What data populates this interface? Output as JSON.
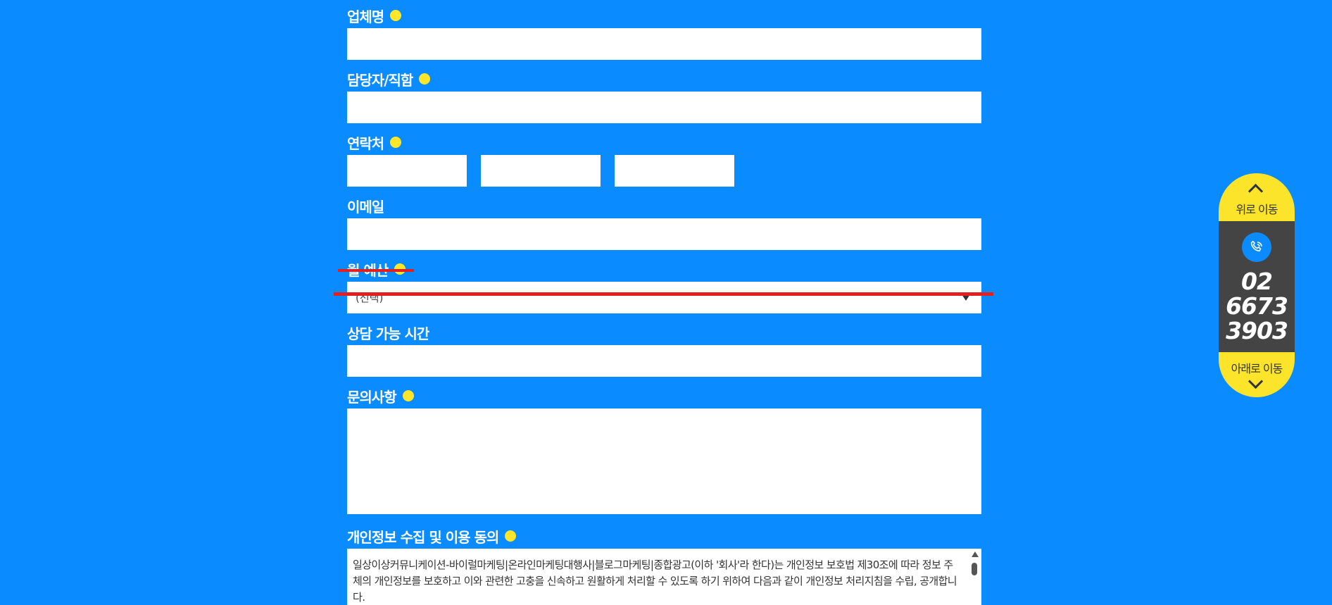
{
  "form": {
    "company_label": "업체명",
    "contact_person_label": "담당자/직함",
    "phone_label": "연락처",
    "email_label": "이메일",
    "budget_label": "월 예산",
    "budget_select_value": "(선택)",
    "consult_time_label": "상담 가능 시간",
    "inquiry_label": "문의사항",
    "privacy_label": "개인정보 수집 및 이용 동의",
    "privacy_text": "일상이상커뮤니케이션-바이럴마케팅|온라인마케팅대행사|블로그마케팅|종합광고(이하 '회사'라 한다)는 개인정보 보호법 제30조에 따라 정보 주체의 개인정보를 보호하고 이와 관련한 고충을 신속하고 원활하게 처리할 수 있도록 하기 위하여 다음과 같이 개인정보 처리지침을 수립, 공개합니다."
  },
  "quick_nav": {
    "top_label": "위로 이동",
    "phone_line1": "02",
    "phone_line2": "6673",
    "phone_line3": "3903",
    "bottom_label": "아래로 이동"
  },
  "colors": {
    "background": "#0a8bff",
    "required_dot": "#ffe62a",
    "nav_yellow": "#fbe429",
    "nav_dark": "#444444",
    "strike_red": "#e32020"
  }
}
